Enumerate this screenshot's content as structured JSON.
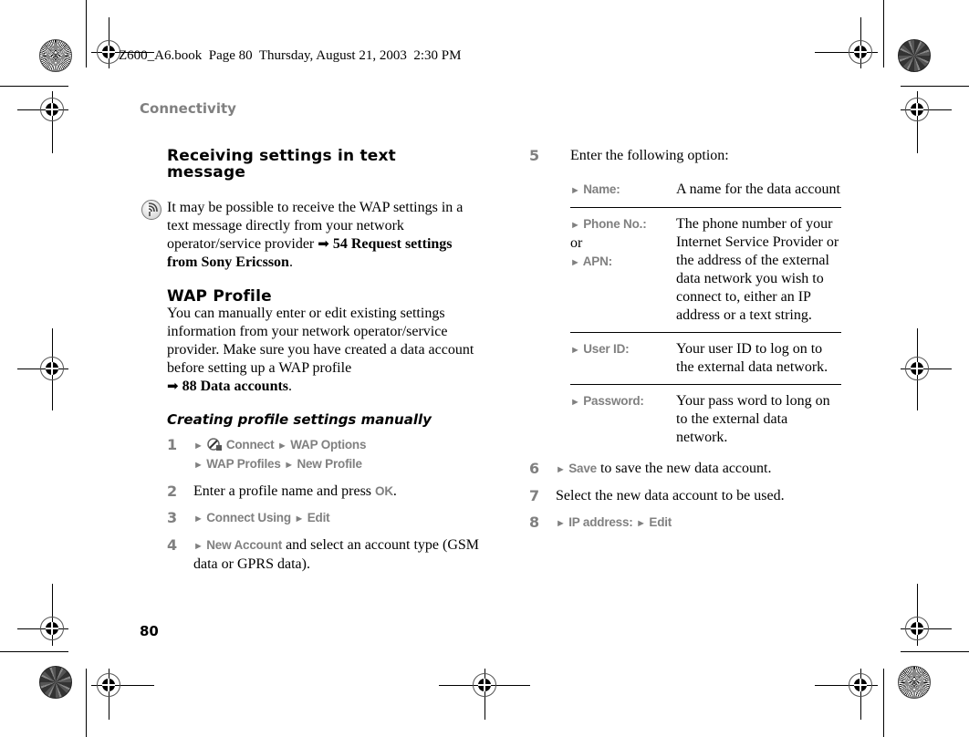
{
  "slug": "Z600_A6.book  Page 80  Thursday, August 21, 2003  2:30 PM",
  "running_head": "Connectivity",
  "page_number": "80",
  "left_column": {
    "section1": {
      "title": "Receiving settings in text message",
      "note_icon": "network-operator-icon",
      "note_text": "It may be possible to receive the WAP settings in a text message directly from your network operator/service provider ",
      "note_arrow": "➡",
      "note_ref": " 54 Request settings from Sony Ericsson",
      "note_end": "."
    },
    "section2": {
      "title": "WAP Profile",
      "body": "You can manually enter or edit existing settings information from your network operator/service provider. Make sure you have created a data account before setting up a WAP profile",
      "arrow": "➡",
      "ref": " 88 Data accounts",
      "end": "."
    },
    "section3": {
      "title": "Creating profile settings manually"
    },
    "steps": [
      {
        "num": "1",
        "menu_icon": "connect-icon",
        "path": [
          "Connect",
          "WAP Options",
          "WAP Profiles",
          "New Profile"
        ]
      },
      {
        "num": "2",
        "text_before": "Enter a profile name and press ",
        "key": "OK",
        "text_after": "."
      },
      {
        "num": "3",
        "path": [
          "Connect Using",
          "Edit"
        ]
      },
      {
        "num": "4",
        "key": "New Account",
        "text_after": " and select an account type (GSM data or GPRS data)."
      }
    ]
  },
  "right_column": {
    "step5": {
      "num": "5",
      "text": "Enter the following option:"
    },
    "options_table": [
      {
        "key": "Name:",
        "value": "A name for the data account"
      },
      {
        "key": "Phone No.:",
        "or": "or",
        "key2": "APN:",
        "value": "The phone number of your Internet Service Provider or the address of the external data network you wish to connect to, either an IP address or a text string."
      },
      {
        "key": "User ID:",
        "value": "Your user ID to log on to the external data network."
      },
      {
        "key": "Password:",
        "value": "Your pass word to long on to the external data network."
      }
    ],
    "step6": {
      "num": "6",
      "key": "Save",
      "text_after": " to save the new data account."
    },
    "step7": {
      "num": "7",
      "text": "Select the new data account to be used."
    },
    "step8": {
      "num": "8",
      "path": [
        "IP address:",
        "Edit"
      ]
    },
    "triangle": "►"
  },
  "colors": {
    "menu_gray": "#808080",
    "text": "#000000"
  }
}
